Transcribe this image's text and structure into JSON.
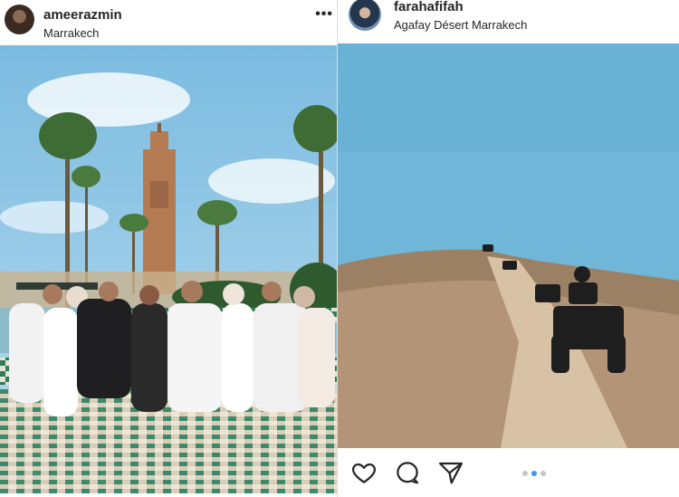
{
  "posts": [
    {
      "username": "ameerazmin",
      "location": "Marrakech",
      "more_label": "•••"
    },
    {
      "username": "farahafifah",
      "location": "Agafay Désert Marrakech",
      "carousel": {
        "total": 3,
        "active": 2
      }
    }
  ],
  "icons": [
    "more-icon",
    "heart-icon",
    "comment-icon",
    "share-icon"
  ],
  "colors": {
    "carousel_active": "#3897f0",
    "carousel_inactive": "#c6c6c6",
    "sky": "#6fb6d8"
  }
}
